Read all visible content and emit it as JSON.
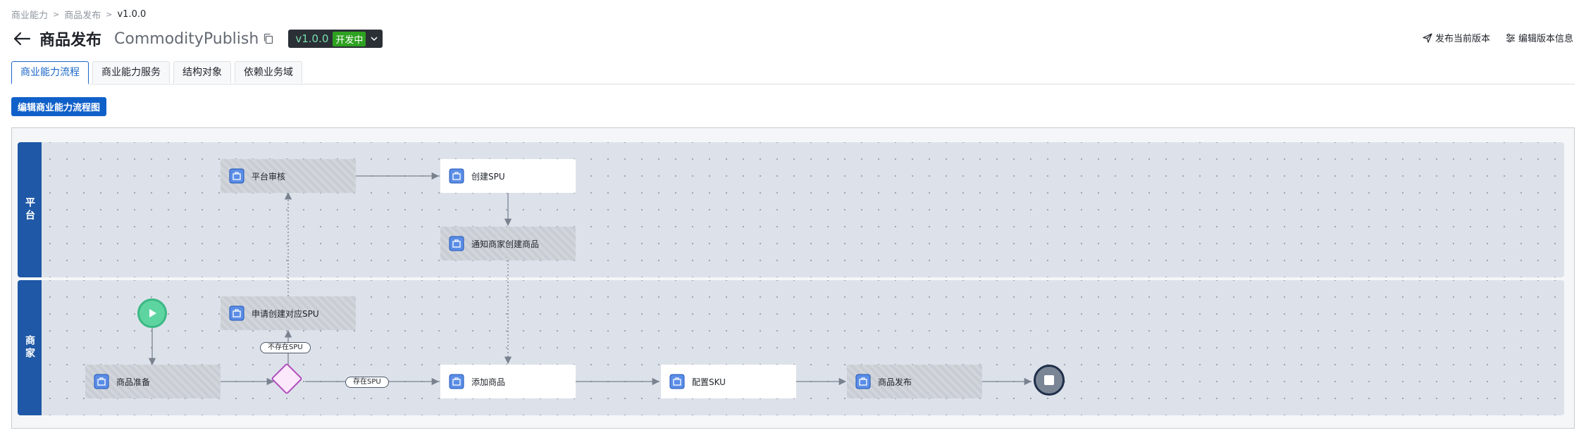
{
  "breadcrumb": {
    "items": [
      "商业能力",
      "商品发布"
    ],
    "current": "v1.0.0"
  },
  "header": {
    "title": "商品发布",
    "code": "CommodityPublish",
    "version": "v1.0.0",
    "status": "开发中"
  },
  "actions": {
    "publish": "发布当前版本",
    "edit_info": "编辑版本信息"
  },
  "tabs": [
    "商业能力流程",
    "商业能力服务",
    "结构对象",
    "依赖业务域"
  ],
  "edit_button": "编辑商业能力流程图",
  "lanes": {
    "platform": "平台",
    "merchant": "商家"
  },
  "nodes": {
    "platform_review": "平台审核",
    "create_spu": "创建SPU",
    "notify_merchant": "通知商家创建商品",
    "apply_spu": "申请创建对应SPU",
    "prepare": "商品准备",
    "add_goods": "添加商品",
    "config_sku": "配置SKU",
    "publish": "商品发布"
  },
  "edge_labels": {
    "no_spu": "不存在SPU",
    "has_spu": "存在SPU"
  },
  "colors": {
    "primary": "#1060c9",
    "lane_header": "#1e58a6",
    "start": "#5ed4a1",
    "gateway": "#b14cbf",
    "end": "#1f2f4a"
  }
}
